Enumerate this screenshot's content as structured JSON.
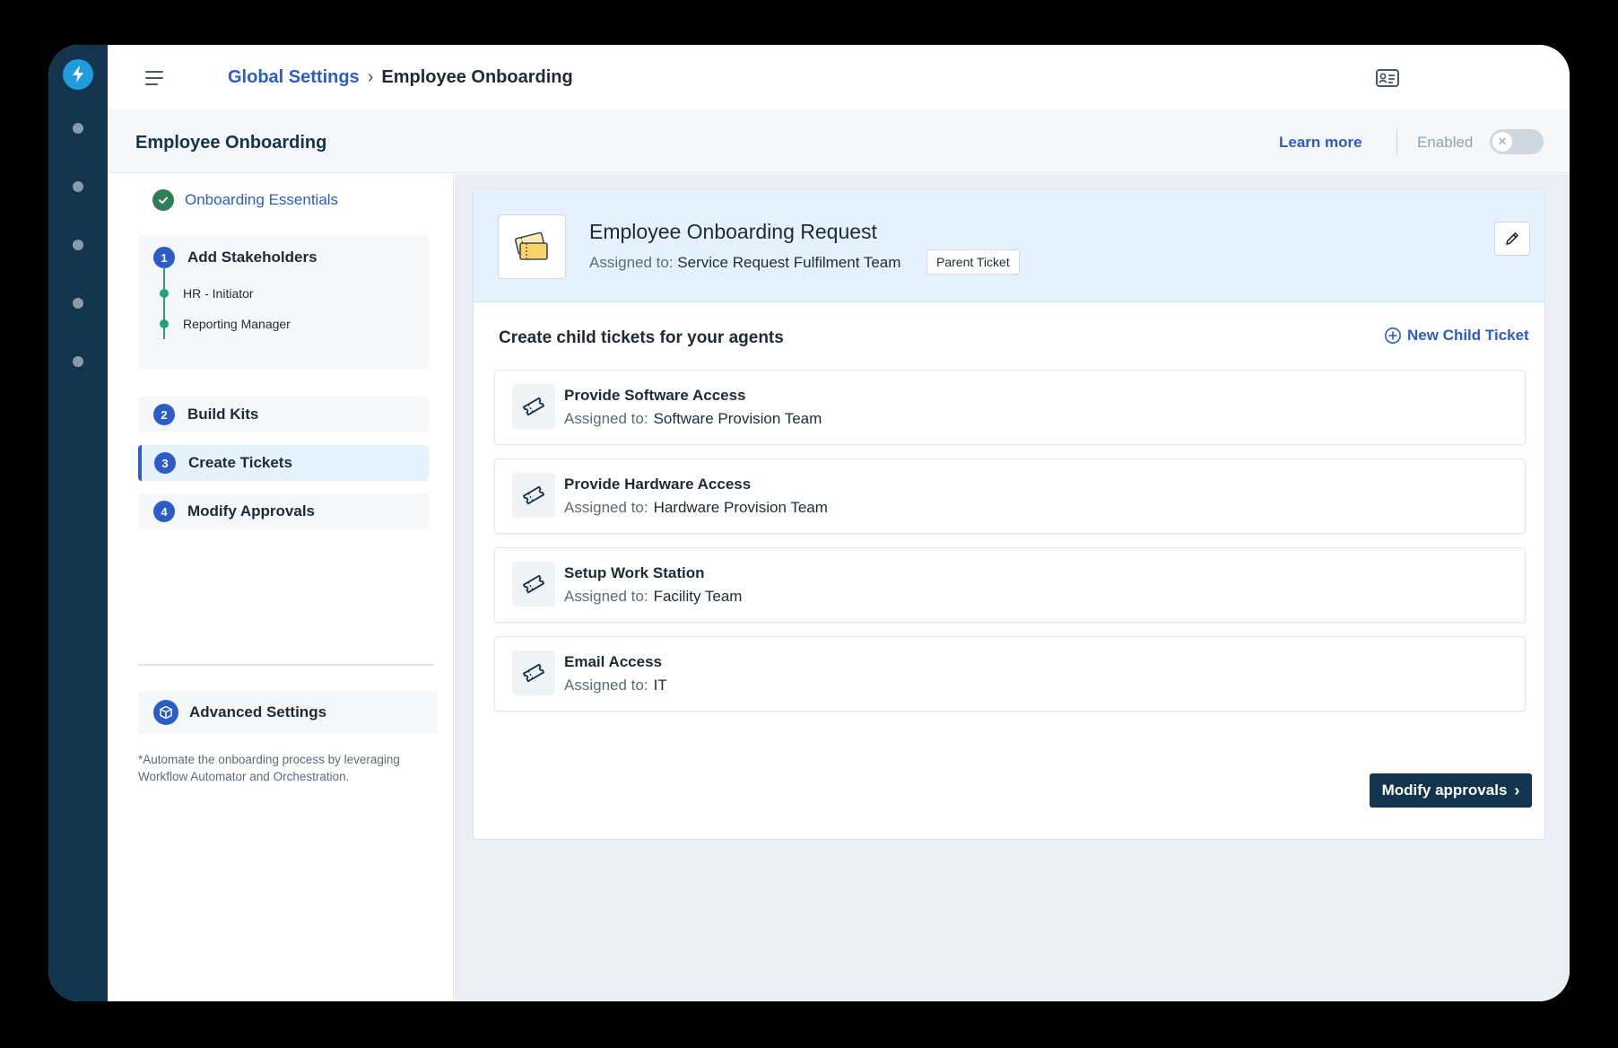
{
  "topbar": {
    "breadcrumb_parent": "Global Settings",
    "breadcrumb_separator": "›",
    "breadcrumb_current": "Employee Onboarding"
  },
  "subheader": {
    "title": "Employee Onboarding",
    "learn_more": "Learn more",
    "enabled_label": "Enabled",
    "toggle_state": "off",
    "toggle_glyph": "✕"
  },
  "steps": {
    "essentials": "Onboarding Essentials",
    "items": [
      {
        "number": "1",
        "label": "Add Stakeholders",
        "sub_items": [
          "HR - Initiator",
          "Reporting Manager"
        ]
      },
      {
        "number": "2",
        "label": "Build Kits"
      },
      {
        "number": "3",
        "label": "Create Tickets",
        "active": true
      },
      {
        "number": "4",
        "label": "Modify Approvals"
      }
    ],
    "advanced": "Advanced Settings",
    "note": "*Automate the onboarding process by leveraging Workflow Automator and Orchestration."
  },
  "parent_ticket": {
    "title": "Employee Onboarding Request",
    "assigned_label": "Assigned to:",
    "assigned_to": "Service Request Fulfilment Team",
    "badge": "Parent Ticket"
  },
  "children": {
    "section_title": "Create child tickets for your agents",
    "new_button": "New Child Ticket",
    "assigned_label": "Assigned to:",
    "items": [
      {
        "title": "Provide Software Access",
        "assigned_to": "Software Provision Team"
      },
      {
        "title": "Provide Hardware Access",
        "assigned_to": "Hardware Provision Team"
      },
      {
        "title": "Setup Work Station",
        "assigned_to": "Facility Team"
      },
      {
        "title": "Email Access",
        "assigned_to": "IT"
      }
    ]
  },
  "cta": {
    "label": "Modify approvals",
    "chevron": "›"
  },
  "colors": {
    "brand_navy": "#12344d",
    "link_blue": "#2c5cc5",
    "success_green": "#25a07b",
    "header_blue": "#e5f2fd",
    "logo_blue": "#1f9be0"
  },
  "icons": {
    "logo": "lightning-bolt-icon",
    "menu": "hamburger-menu-icon",
    "topbar": "id-card-icon",
    "essentials": "check-circle-icon",
    "advanced": "cube-icon",
    "edit": "pencil-icon",
    "new_child": "plus-circle-icon",
    "ticket": "ticket-icon"
  }
}
